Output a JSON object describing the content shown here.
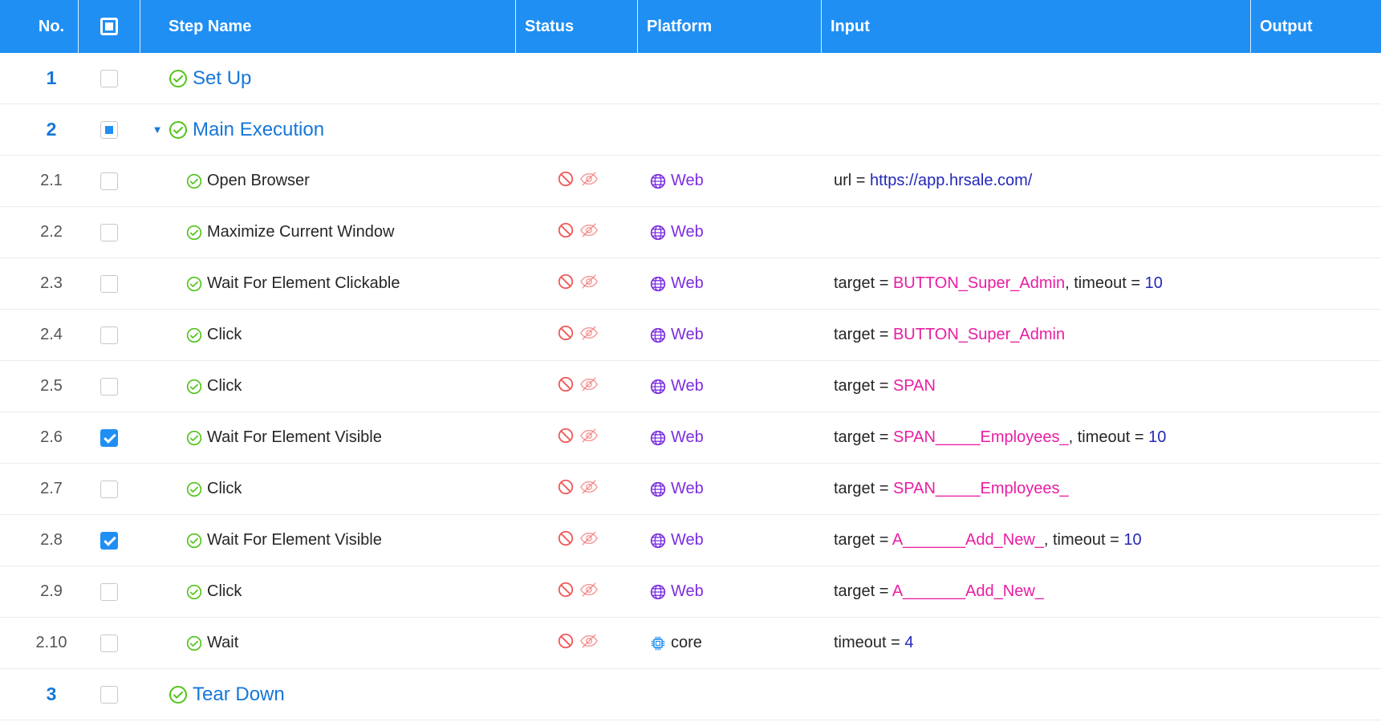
{
  "header": {
    "no": "No.",
    "step_name": "Step Name",
    "status": "Status",
    "platform": "Platform",
    "input": "Input",
    "output": "Output"
  },
  "colors": {
    "header_bg": "#1f8ff4",
    "group_text": "#1677d9",
    "ok_icon": "#52c41a",
    "status_icon": "#f05a5a",
    "web_platform": "#7b2ee0",
    "core_icon": "#1f8ff4",
    "input_string": "#e81ea2",
    "input_number": "#2328b8"
  },
  "rows": [
    {
      "no": "1",
      "level": 0,
      "check": "unchecked",
      "name": "Set Up"
    },
    {
      "no": "2",
      "level": 0,
      "check": "partial",
      "expanded": true,
      "name": "Main Execution"
    },
    {
      "no": "2.1",
      "level": 1,
      "check": "unchecked",
      "name": "Open Browser",
      "platform": "Web",
      "platform_icon": "globe-icon",
      "input": [
        {
          "k": "url = "
        },
        {
          "v": "https://app.hrsale.com/",
          "t": "url"
        }
      ]
    },
    {
      "no": "2.2",
      "level": 1,
      "check": "unchecked",
      "name": "Maximize Current Window",
      "platform": "Web",
      "platform_icon": "globe-icon",
      "input": []
    },
    {
      "no": "2.3",
      "level": 1,
      "check": "unchecked",
      "name": "Wait For Element Clickable",
      "platform": "Web",
      "platform_icon": "globe-icon",
      "input": [
        {
          "k": "target = "
        },
        {
          "v": "BUTTON_Super_Admin",
          "t": "str"
        },
        {
          "k": ", timeout = "
        },
        {
          "v": "10",
          "t": "num"
        }
      ]
    },
    {
      "no": "2.4",
      "level": 1,
      "check": "unchecked",
      "name": "Click",
      "platform": "Web",
      "platform_icon": "globe-icon",
      "input": [
        {
          "k": "target = "
        },
        {
          "v": "BUTTON_Super_Admin",
          "t": "str"
        }
      ]
    },
    {
      "no": "2.5",
      "level": 1,
      "check": "unchecked",
      "name": "Click",
      "platform": "Web",
      "platform_icon": "globe-icon",
      "input": [
        {
          "k": "target = "
        },
        {
          "v": "SPAN",
          "t": "str"
        }
      ]
    },
    {
      "no": "2.6",
      "level": 1,
      "check": "checked",
      "name": "Wait For Element Visible",
      "platform": "Web",
      "platform_icon": "globe-icon",
      "input": [
        {
          "k": "target = "
        },
        {
          "v": "SPAN_____Employees_",
          "t": "str"
        },
        {
          "k": ", timeout = "
        },
        {
          "v": "10",
          "t": "num"
        }
      ]
    },
    {
      "no": "2.7",
      "level": 1,
      "check": "unchecked",
      "name": "Click",
      "platform": "Web",
      "platform_icon": "globe-icon",
      "input": [
        {
          "k": "target = "
        },
        {
          "v": "SPAN_____Employees_",
          "t": "str"
        }
      ]
    },
    {
      "no": "2.8",
      "level": 1,
      "check": "checked",
      "name": "Wait For Element Visible",
      "platform": "Web",
      "platform_icon": "globe-icon",
      "input": [
        {
          "k": "target = "
        },
        {
          "v": "A_______Add_New_",
          "t": "str"
        },
        {
          "k": ", timeout = "
        },
        {
          "v": "10",
          "t": "num"
        }
      ]
    },
    {
      "no": "2.9",
      "level": 1,
      "check": "unchecked",
      "name": "Click",
      "platform": "Web",
      "platform_icon": "globe-icon",
      "input": [
        {
          "k": "target = "
        },
        {
          "v": "A_______Add_New_",
          "t": "str"
        }
      ]
    },
    {
      "no": "2.10",
      "level": 1,
      "check": "unchecked",
      "name": "Wait",
      "platform": "core",
      "platform_icon": "chip-icon",
      "input": [
        {
          "k": "timeout = "
        },
        {
          "v": "4",
          "t": "num"
        }
      ]
    },
    {
      "no": "3",
      "level": 0,
      "check": "unchecked",
      "name": "Tear Down"
    }
  ]
}
